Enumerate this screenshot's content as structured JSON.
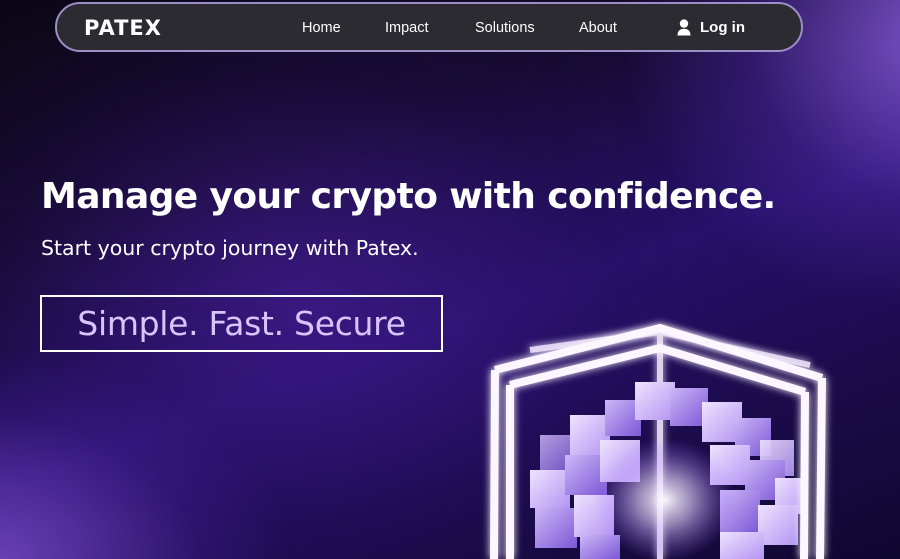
{
  "navbar": {
    "logo": "PATEX",
    "links": [
      {
        "label": "Home"
      },
      {
        "label": "Impact"
      },
      {
        "label": "Solutions"
      },
      {
        "label": "About"
      }
    ],
    "login_label": "Log in",
    "login_icon": "user-icon"
  },
  "hero": {
    "title": "Manage your crypto with confidence.",
    "subtitle": "Start your crypto journey with Patex.",
    "tagline": "Simple. Fast. Secure"
  },
  "illustration": {
    "name": "glowing-cube-illustration"
  },
  "colors": {
    "navbar_bg": "#2b2b31",
    "navbar_border": "#9c8fc8",
    "tagline": "#d9c4ff",
    "accent_purple": "#6a3fd0",
    "background_dark": "#0b0716"
  }
}
